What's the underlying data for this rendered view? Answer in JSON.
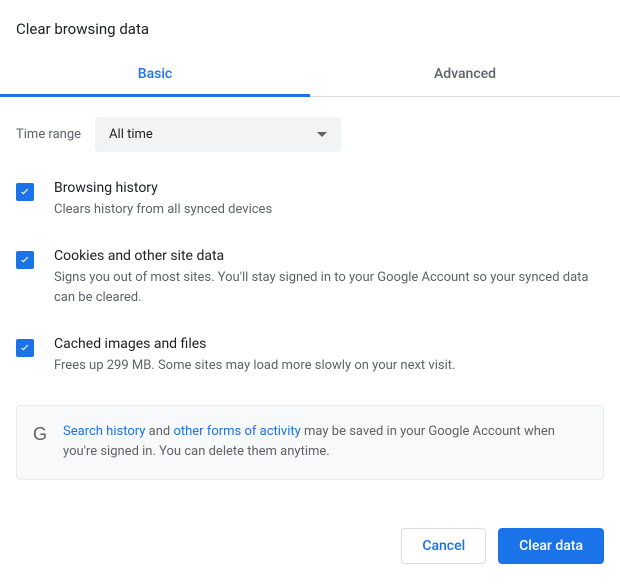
{
  "title": "Clear browsing data",
  "tabs": {
    "basic": "Basic",
    "advanced": "Advanced"
  },
  "time": {
    "label": "Time range",
    "value": "All time"
  },
  "options": {
    "history": {
      "title": "Browsing history",
      "desc": "Clears history from all synced devices"
    },
    "cookies": {
      "title": "Cookies and other site data",
      "desc": "Signs you out of most sites. You'll stay signed in to your Google Account so your synced data can be cleared."
    },
    "cache": {
      "title": "Cached images and files",
      "desc": "Frees up 299 MB. Some sites may load more slowly on your next visit."
    }
  },
  "notice": {
    "link1": "Search history",
    "mid1": " and ",
    "link2": "other forms of activity",
    "rest": " may be saved in your Google Account when you're signed in. You can delete them anytime."
  },
  "buttons": {
    "cancel": "Cancel",
    "clear": "Clear data"
  }
}
